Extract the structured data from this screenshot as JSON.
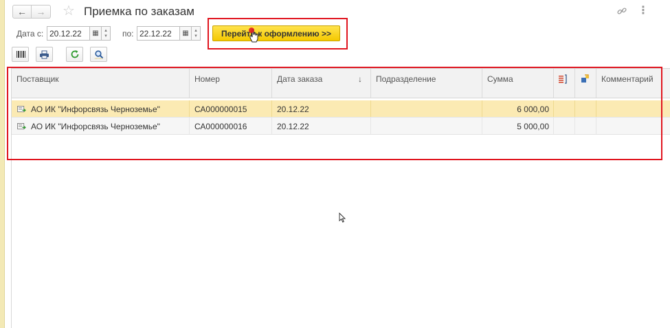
{
  "header": {
    "back_label": "←",
    "forward_label": "→",
    "favorite_glyph": "☆",
    "title": "Приемка по заказам",
    "link_glyph": "🔗",
    "menu_glyph": "⋮"
  },
  "filter": {
    "date_from_label": "Дата с:",
    "date_from_value": "20.12.22",
    "date_to_label": "по:",
    "date_to_value": "22.12.22",
    "go_button_label": "Перейти к оформлению >>"
  },
  "toolbar": {
    "icons": [
      "barcode-icon",
      "print-icon",
      "refresh-icon",
      "search-icon"
    ]
  },
  "table": {
    "columns": [
      {
        "label": "Поставщик"
      },
      {
        "label": "Номер"
      },
      {
        "label": "Дата заказа",
        "sort": "↓"
      },
      {
        "label": "Подразделение"
      },
      {
        "label": "Сумма"
      },
      {
        "label": ""
      },
      {
        "label": ""
      },
      {
        "label": "Комментарий"
      }
    ],
    "rows": [
      {
        "supplier": "АО ИК \"Инфорсвязь Черноземье\"",
        "number": "СА000000015",
        "date": "20.12.22",
        "division": "",
        "sum": "6 000,00",
        "comment": "",
        "selected": true
      },
      {
        "supplier": "АО ИК \"Инфорсвязь Черноземье\"",
        "number": "СА000000016",
        "date": "20.12.22",
        "division": "",
        "sum": "5 000,00",
        "comment": "",
        "selected": false
      }
    ]
  },
  "colors": {
    "accent_button": "#f4c800",
    "selected_row": "#fbeab3",
    "highlight_frame": "#e0141e"
  }
}
